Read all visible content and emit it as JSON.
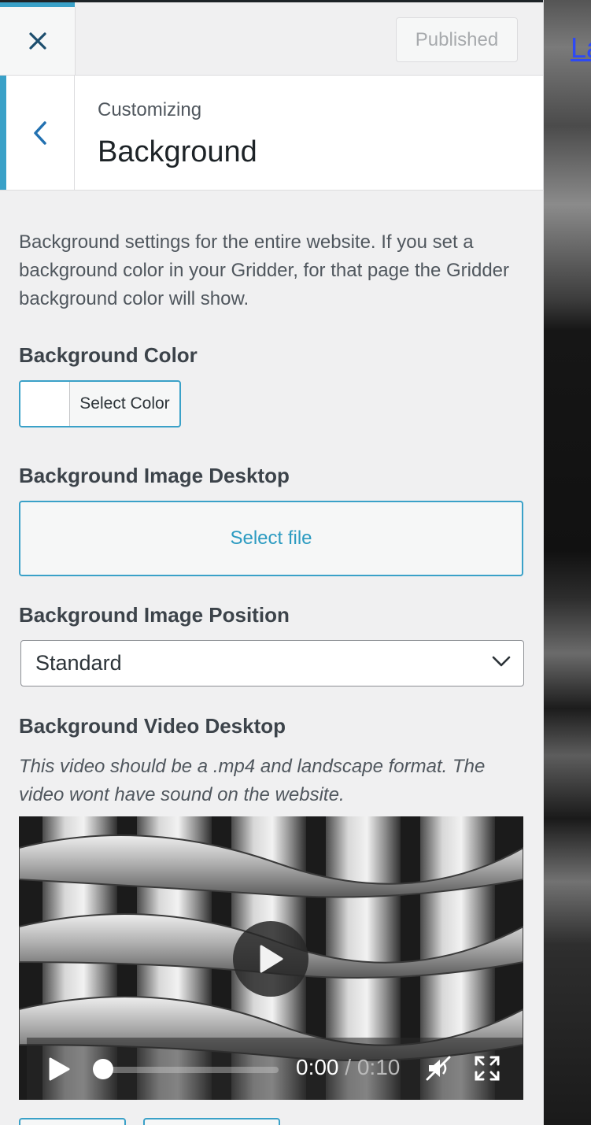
{
  "header": {
    "close_icon": "close-icon",
    "published_label": "Published"
  },
  "section": {
    "back_icon": "chevron-left-icon",
    "breadcrumb": "Customizing",
    "title": "Background"
  },
  "content": {
    "description": "Background settings for the entire website. If you set a background color in your Gridder, for that page the Gridder background color will show.",
    "background_color": {
      "label": "Background Color",
      "button_label": "Select Color",
      "swatch_color": "#ffffff"
    },
    "background_image": {
      "label": "Background Image Desktop",
      "button_label": "Select file"
    },
    "image_position": {
      "label": "Background Image Position",
      "selected": "Standard"
    },
    "background_video": {
      "label": "Background Video Desktop",
      "note": "This video should be a .mp4 and landscape format. The video wont have sound on the website.",
      "current_time": "0:00",
      "separator": "/",
      "duration": "0:10",
      "progress": 0
    }
  },
  "preview": {
    "link_text": "La"
  },
  "colors": {
    "accent": "#3aa1c8",
    "panel_bg": "#f0f0f1"
  }
}
